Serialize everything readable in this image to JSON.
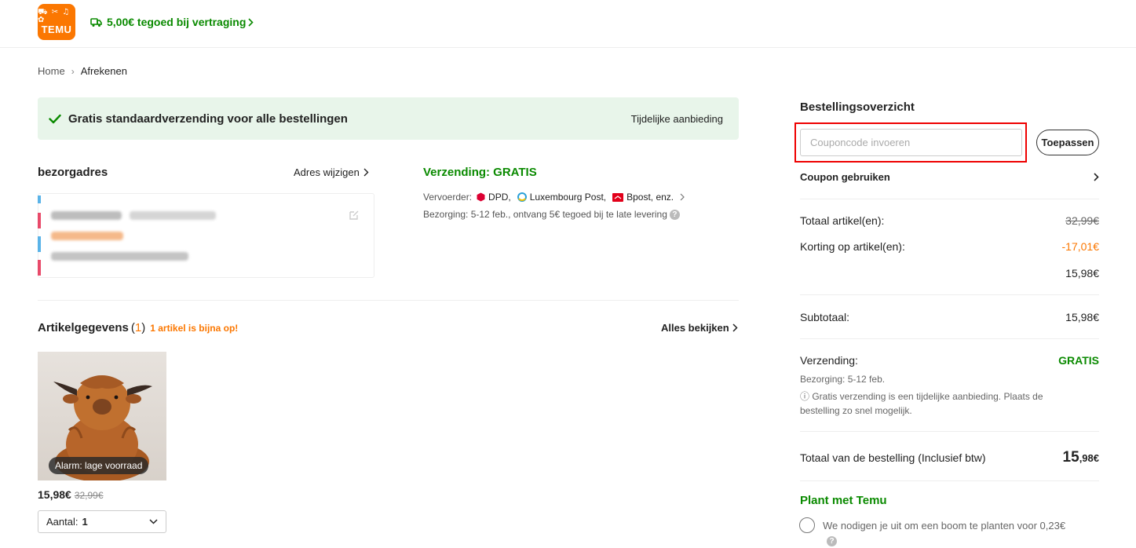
{
  "header": {
    "logo_glyphs": "⛟ ✂ ♫ ✿",
    "logo_text": "TEMU",
    "promo": "5,00€ tegoed bij vertraging"
  },
  "breadcrumb": {
    "home": "Home",
    "separator": "›",
    "current": "Afrekenen"
  },
  "banner": {
    "text": "Gratis standaardverzending voor alle bestellingen",
    "right": "Tijdelijke aanbieding"
  },
  "address": {
    "title": "bezorgadres",
    "change": "Adres wijzigen"
  },
  "shipping": {
    "title": "Verzending: GRATIS",
    "carrier_label": "Vervoerder:",
    "carriers": [
      "DPD,",
      "Luxembourg Post,",
      "Bpost, enz."
    ],
    "delivery": "Bezorging: 5-12 feb., ontvang 5€ tegoed bij te late levering"
  },
  "items": {
    "title": "Artikelgegevens",
    "count_open": "(",
    "count": "1",
    "count_close": ")",
    "warning": "1 artikel is bijna op!",
    "view_all": "Alles bekijken",
    "product": {
      "stock_tag": "Alarm: lage voorraad",
      "price": "15,98€",
      "old_price": "32,99€",
      "qty_label": "Aantal:",
      "qty_value": "1"
    }
  },
  "summary": {
    "title": "Bestellingsoverzicht",
    "coupon_placeholder": "Couponcode invoeren",
    "apply": "Toepassen",
    "use_coupon": "Coupon gebruiken",
    "total_items_label": "Totaal artikel(en):",
    "total_items_value": "32,99€",
    "discount_label": "Korting op artikel(en):",
    "discount_value": "-17,01€",
    "after_discount": "15,98€",
    "subtotal_label": "Subtotaal:",
    "subtotal_value": "15,98€",
    "shipping_label": "Verzending:",
    "shipping_value": "GRATIS",
    "shipping_delivery": "Bezorging: 5-12 feb.",
    "shipping_note": "ⓘ  Gratis verzending is een tijdelijke aanbieding. Plaats de bestelling zo snel mogelijk.",
    "order_total_label": "Totaal van de bestelling (Inclusief btw)",
    "order_total_int": "15",
    "order_total_dec": ",98€",
    "plant_title": "Plant met Temu",
    "plant_text": "We nodigen je uit om een boom te planten voor 0,23€"
  },
  "colors": {
    "brand": "#fb7701",
    "green": "#0a8a00",
    "highlight": "#e00000"
  }
}
